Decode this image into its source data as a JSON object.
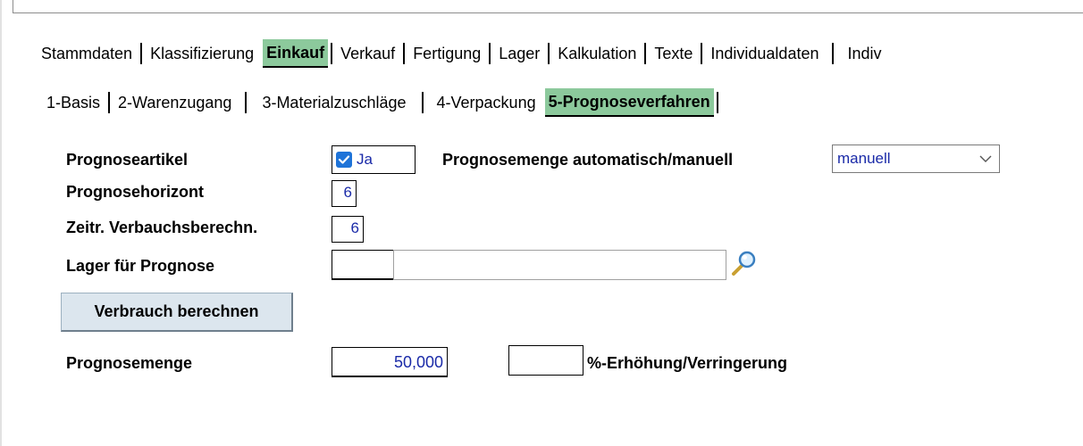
{
  "main_tabs": [
    {
      "label": "Stammdaten",
      "active": false
    },
    {
      "label": "Klassifizierung",
      "active": false
    },
    {
      "label": "Einkauf",
      "active": true
    },
    {
      "label": "Verkauf",
      "active": false
    },
    {
      "label": "Fertigung",
      "active": false
    },
    {
      "label": "Lager",
      "active": false
    },
    {
      "label": "Kalkulation",
      "active": false
    },
    {
      "label": "Texte",
      "active": false
    },
    {
      "label": "Individualdaten",
      "active": false
    },
    {
      "label": "Indiv",
      "active": false
    }
  ],
  "sub_tabs": [
    {
      "label": "1-Basis",
      "active": false
    },
    {
      "label": "2-Warenzugang",
      "active": false
    },
    {
      "label": "3-Materialzuschläge",
      "active": false
    },
    {
      "label": "4-Verpackung",
      "active": false
    },
    {
      "label": "5-Prognoseverfahren",
      "active": true
    }
  ],
  "form": {
    "prognoseartikel_label": "Prognoseartikel",
    "prognoseartikel_value": "Ja",
    "prognoseartikel_checked": true,
    "prognosemenge_mode_label": "Prognosemenge automatisch/manuell",
    "prognosemenge_mode_value": "manuell",
    "prognosehorizont_label": "Prognosehorizont",
    "prognosehorizont_value": "6",
    "zeitr_label": "Zeitr. Verbauchsberechn.",
    "zeitr_value": "6",
    "lager_label": "Lager für Prognose",
    "lager_code": "",
    "lager_name": "",
    "verbrauch_button": "Verbrauch berechnen",
    "prognosemenge_label": "Prognosemenge",
    "prognosemenge_value": "50,000",
    "erhoehung_value": "",
    "erhoehung_label": "%-Erhöhung/Verringerung"
  },
  "colors": {
    "active_tab": "#8cc99c",
    "value_text": "#1a2aa8",
    "checkbox": "#1e73d8",
    "button_bg": "#dce6ee"
  },
  "icons": {
    "lookup": "magnifier-icon",
    "dropdown": "chevron-down-icon",
    "check": "checkmark-icon"
  }
}
